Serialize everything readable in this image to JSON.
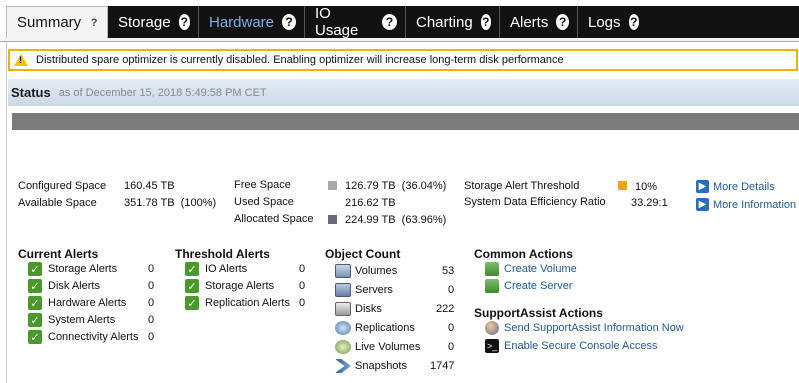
{
  "tabs": [
    {
      "label": "Summary"
    },
    {
      "label": "Storage"
    },
    {
      "label": "Hardware"
    },
    {
      "label": "IO Usage"
    },
    {
      "label": "Charting"
    },
    {
      "label": "Alerts"
    },
    {
      "label": "Logs"
    }
  ],
  "help_glyph": "?",
  "warning": {
    "text": "Distributed spare optimizer is currently disabled. Enabling optimizer will increase long-term disk performance"
  },
  "status": {
    "title": "Status",
    "timestamp": "as of December 15, 2018 5:49:58 PM CET"
  },
  "capacity": {
    "configured_label": "Configured Space",
    "configured_value": "160.45 TB",
    "available_label": "Available Space",
    "available_value": "351.78 TB  (100%)",
    "free_label": "Free Space",
    "free_value": "126.79 TB  (36.04%)",
    "used_label": "Used Space",
    "used_value": "216.62 TB",
    "allocated_label": "Allocated Space",
    "allocated_value": "224.99 TB  (63.96%)",
    "threshold_label": "Storage Alert Threshold",
    "threshold_value": "10%",
    "efficiency_label": "System Data Efficiency Ratio",
    "efficiency_value": "33.29:1",
    "more_details": "More Details",
    "more_information": "More Information",
    "colors": {
      "free": "#a8a8a8",
      "allocated": "#6a6a7a",
      "threshold": "#f0a800",
      "bar": "#7b7b7b"
    }
  },
  "current_alerts": {
    "title": "Current Alerts",
    "items": [
      {
        "label": "Storage Alerts",
        "count": "0"
      },
      {
        "label": "Disk Alerts",
        "count": "0"
      },
      {
        "label": "Hardware Alerts",
        "count": "0"
      },
      {
        "label": "System Alerts",
        "count": "0"
      },
      {
        "label": "Connectivity Alerts",
        "count": "0"
      }
    ]
  },
  "threshold_alerts": {
    "title": "Threshold Alerts",
    "items": [
      {
        "label": "IO Alerts",
        "count": "0"
      },
      {
        "label": "Storage Alerts",
        "count": "0"
      },
      {
        "label": "Replication Alerts",
        "count": "0"
      }
    ]
  },
  "object_count": {
    "title": "Object Count",
    "items": [
      {
        "label": "Volumes",
        "count": "53",
        "icon": "volumes-icon"
      },
      {
        "label": "Servers",
        "count": "0",
        "icon": "servers-icon"
      },
      {
        "label": "Disks",
        "count": "222",
        "icon": "disks-icon"
      },
      {
        "label": "Replications",
        "count": "0",
        "icon": "replications-icon"
      },
      {
        "label": "Live Volumes",
        "count": "0",
        "icon": "live-volumes-icon"
      },
      {
        "label": "Snapshots",
        "count": "1747",
        "icon": "snapshots-icon"
      }
    ]
  },
  "common_actions": {
    "title": "Common Actions",
    "create_volume": "Create Volume",
    "create_server": "Create Server"
  },
  "supportassist": {
    "title": "SupportAssist Actions",
    "send_info": "Send SupportAssist Information Now",
    "secure_console": "Enable Secure Console Access"
  }
}
